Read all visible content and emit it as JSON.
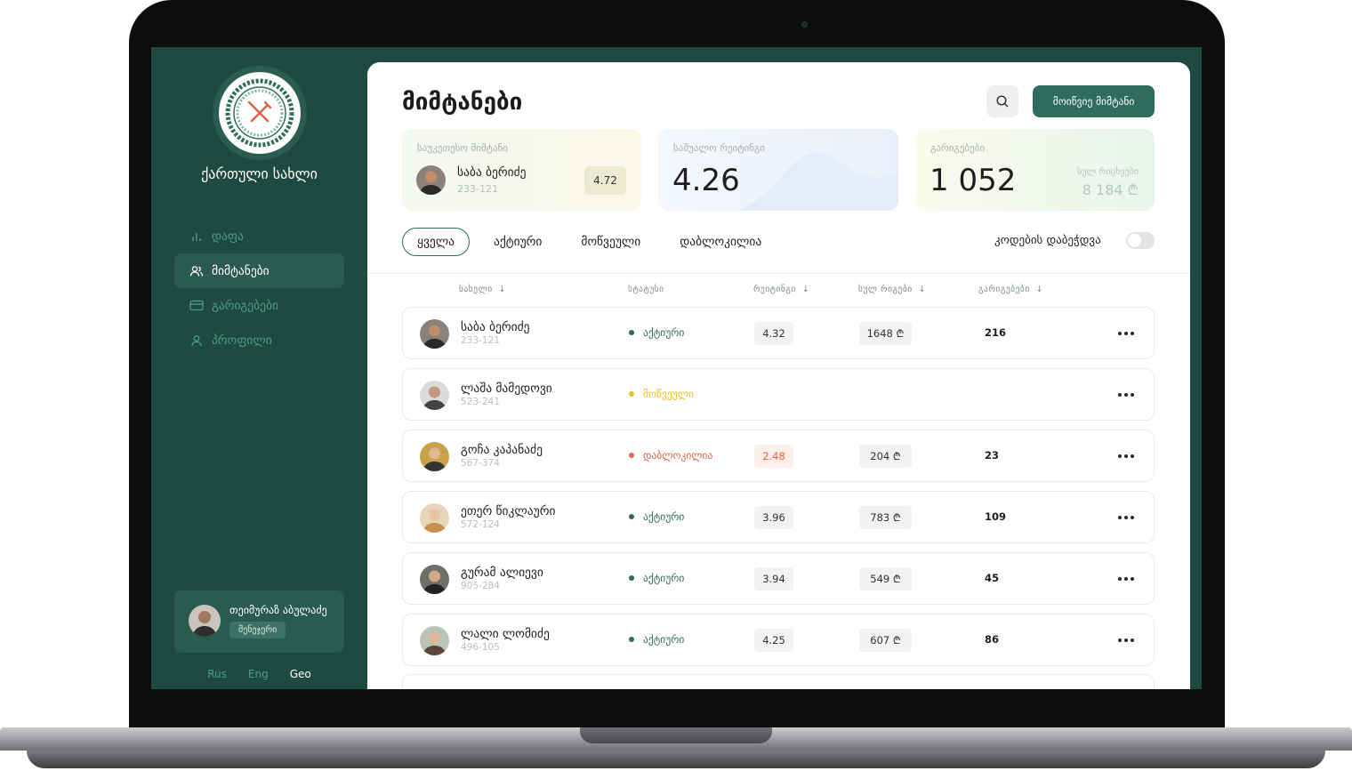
{
  "sidebar": {
    "restaurant_name": "ქართული სახლი",
    "nav": [
      {
        "label": "დაფა",
        "icon": "bar-chart-icon"
      },
      {
        "label": "მიმტანები",
        "icon": "users-icon"
      },
      {
        "label": "გარიგებები",
        "icon": "card-icon"
      },
      {
        "label": "პროფილი",
        "icon": "user-icon"
      }
    ],
    "user": {
      "name": "თეიმურაზ აბულაძე",
      "role": "მენეჯერი"
    },
    "languages": [
      "Rus",
      "Eng",
      "Geo"
    ],
    "active_language": "Geo"
  },
  "header": {
    "title": "მიმტანები",
    "invite_label": "მოიწვიე მიმტანი"
  },
  "stats": {
    "best": {
      "label": "საუკეთესო მიმტანი",
      "name": "საბა ბერიძე",
      "code": "233-121",
      "rating": "4.72"
    },
    "average": {
      "label": "საშუალო რეიტინგი",
      "value": "4.26"
    },
    "deals": {
      "label": "გარიგებები",
      "value": "1 052",
      "sub_label": "სულ რიცხვები",
      "sub_value": "8 184 ₾"
    }
  },
  "filters": {
    "tabs": [
      "ყველა",
      "აქტიური",
      "მოწვეული",
      "დაბლოკილია"
    ],
    "active_tab": "ყველა",
    "merge_label": "კოდების დაბეჭდვა",
    "merge_enabled": false
  },
  "table": {
    "columns": [
      "სახელი",
      "სტატუსი",
      "რეიტინგი",
      "სულ რიგები",
      "გარიგებები"
    ],
    "rows": [
      {
        "name": "საბა ბერიძე",
        "code": "233-121",
        "status": "აქტიური",
        "status_kind": "active",
        "rating": "4.32",
        "orders": "1648 ₾",
        "shifts": "216"
      },
      {
        "name": "ლაშა მამედოვი",
        "code": "523-241",
        "status": "მოწვეული",
        "status_kind": "invited",
        "rating": "",
        "orders": "",
        "shifts": ""
      },
      {
        "name": "გოჩა კაპანაძე",
        "code": "567-374",
        "status": "დაბლოკილია",
        "status_kind": "blocked",
        "rating": "2.48",
        "orders": "204 ₾",
        "shifts": "23"
      },
      {
        "name": "ეთერ წიკლაური",
        "code": "572-124",
        "status": "აქტიური",
        "status_kind": "active",
        "rating": "3.96",
        "orders": "783 ₾",
        "shifts": "109"
      },
      {
        "name": "გურამ ალიევი",
        "code": "905-284",
        "status": "აქტიური",
        "status_kind": "active",
        "rating": "3.94",
        "orders": "549 ₾",
        "shifts": "45"
      },
      {
        "name": "ლალი ლომიძე",
        "code": "496-105",
        "status": "აქტიური",
        "status_kind": "active",
        "rating": "4.25",
        "orders": "607 ₾",
        "shifts": "86"
      }
    ]
  },
  "colors": {
    "brand": "#1f4a3f",
    "accent": "#2e6c5b",
    "active": "#2e6c5b",
    "invited": "#f0c020",
    "blocked": "#e0654a"
  }
}
